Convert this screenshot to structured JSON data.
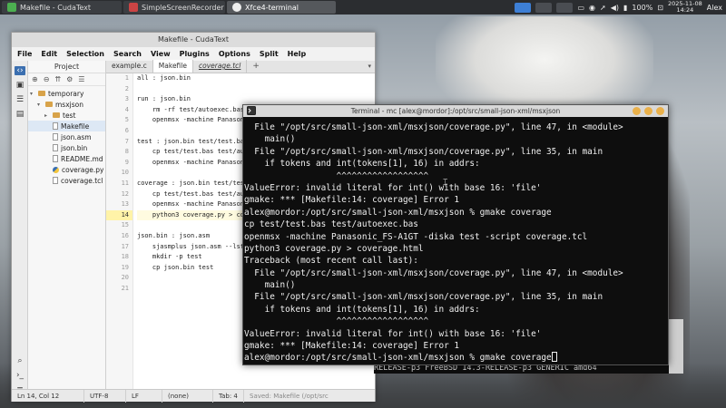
{
  "taskbar": {
    "tasks": [
      {
        "label": "Makefile - CudaText"
      },
      {
        "label": "SimpleScreenRecorder"
      },
      {
        "label": "Xfce4-terminal"
      }
    ],
    "battery": "100%",
    "date": "2025-11-08",
    "time": "14:24",
    "user": "Alex"
  },
  "cuda": {
    "title": "Makefile - CudaText",
    "menu": [
      "File",
      "Edit",
      "Selection",
      "Search",
      "View",
      "Plugins",
      "Options",
      "Split",
      "Help"
    ],
    "panel_title": "Project",
    "tree": [
      {
        "label": "temporary",
        "kind": "folder",
        "level": 0
      },
      {
        "label": "msxjson",
        "kind": "folder",
        "level": 1
      },
      {
        "label": "test",
        "kind": "folder",
        "level": 2
      },
      {
        "label": "Makefile",
        "kind": "file",
        "level": 2
      },
      {
        "label": "json.asm",
        "kind": "file",
        "level": 2
      },
      {
        "label": "json.bin",
        "kind": "file",
        "level": 2
      },
      {
        "label": "README.md",
        "kind": "file",
        "level": 2
      },
      {
        "label": "coverage.py",
        "kind": "py",
        "level": 2
      },
      {
        "label": "coverage.tcl",
        "kind": "file",
        "level": 2
      }
    ],
    "tabs": [
      {
        "label": "example.c"
      },
      {
        "label": "Makefile"
      },
      {
        "label": "coverage.tcl"
      }
    ],
    "tab_plus": "+",
    "line_numbers": [
      "1",
      "2",
      "3",
      "4",
      "5",
      "6",
      "7",
      "8",
      "9",
      "10",
      "11",
      "12",
      "13",
      "14",
      "15",
      "16",
      "17",
      "18",
      "19",
      "20",
      "21"
    ],
    "current_line": "14",
    "code": [
      "all : json.bin",
      "",
      "run : json.bin",
      "\trm -rf test/autoexec.bas",
      "\topenmsx -machine Panasoni",
      "",
      "test : json.bin test/test.bas",
      "\tcp test/test.bas test/autoe",
      "\topenmsx -machine Panasoni",
      "",
      "coverage : json.bin test/test",
      "\tcp test/test.bas test/autoe",
      "\topenmsx -machine Panasoni",
      "\tpython3 coverage.py > cove",
      "",
      "json.bin : json.asm",
      "\tsjasmplus json.asm --lst",
      "\tmkdir -p test",
      "\tcp json.bin test",
      "",
      ""
    ],
    "status": {
      "pos": "Ln 14, Col 12",
      "enc": "UTF-8",
      "eol": "LF",
      "lexer": "(none)",
      "tab": "Tab: 4",
      "saved": "Saved: Makefile (/opt/src"
    }
  },
  "terminal": {
    "title": "Terminal - mc [alex@mordor]:/opt/src/small-json-xml/msxjson",
    "lines": [
      "  File \"/opt/src/small-json-xml/msxjson/coverage.py\", line 47, in <module>",
      "    main()",
      "  File \"/opt/src/small-json-xml/msxjson/coverage.py\", line 35, in main",
      "    if tokens and int(tokens[1], 16) in addrs:",
      "                  ^^^^^^^^^^^^^^^^^^",
      "ValueError: invalid literal for int() with base 16: 'file'",
      "gmake: *** [Makefile:14: coverage] Error 1",
      "alex@mordor:/opt/src/small-json-xml/msxjson % gmake coverage",
      "cp test/test.bas test/autoexec.bas",
      "openmsx -machine Panasonic_FS-A1GT -diska test -script coverage.tcl",
      "python3 coverage.py > coverage.html",
      "Traceback (most recent call last):",
      "  File \"/opt/src/small-json-xml/msxjson/coverage.py\", line 47, in <module>",
      "    main()",
      "  File \"/opt/src/small-json-xml/msxjson/coverage.py\", line 35, in main",
      "    if tokens and int(tokens[1], 16) in addrs:",
      "                  ^^^^^^^^^^^^^^^^^^",
      "ValueError: invalid literal for int() with base 16: 'file'",
      "gmake: *** [Makefile:14: coverage] Error 1"
    ],
    "prompt": "alex@mordor:/opt/src/small-json-xml/msxjson % gmake coverage",
    "mc_line": "RELEASE-p3 FreeBSD 14.3-RELEASE-p3 GENERIC amd64"
  },
  "colors": {
    "taskbar": "#2b2d30",
    "terminal_bg": "#0e0e0e",
    "terminal_fg": "#f0f0f0",
    "accent": "#3b6fb0",
    "current_line": "#fff3a8"
  }
}
